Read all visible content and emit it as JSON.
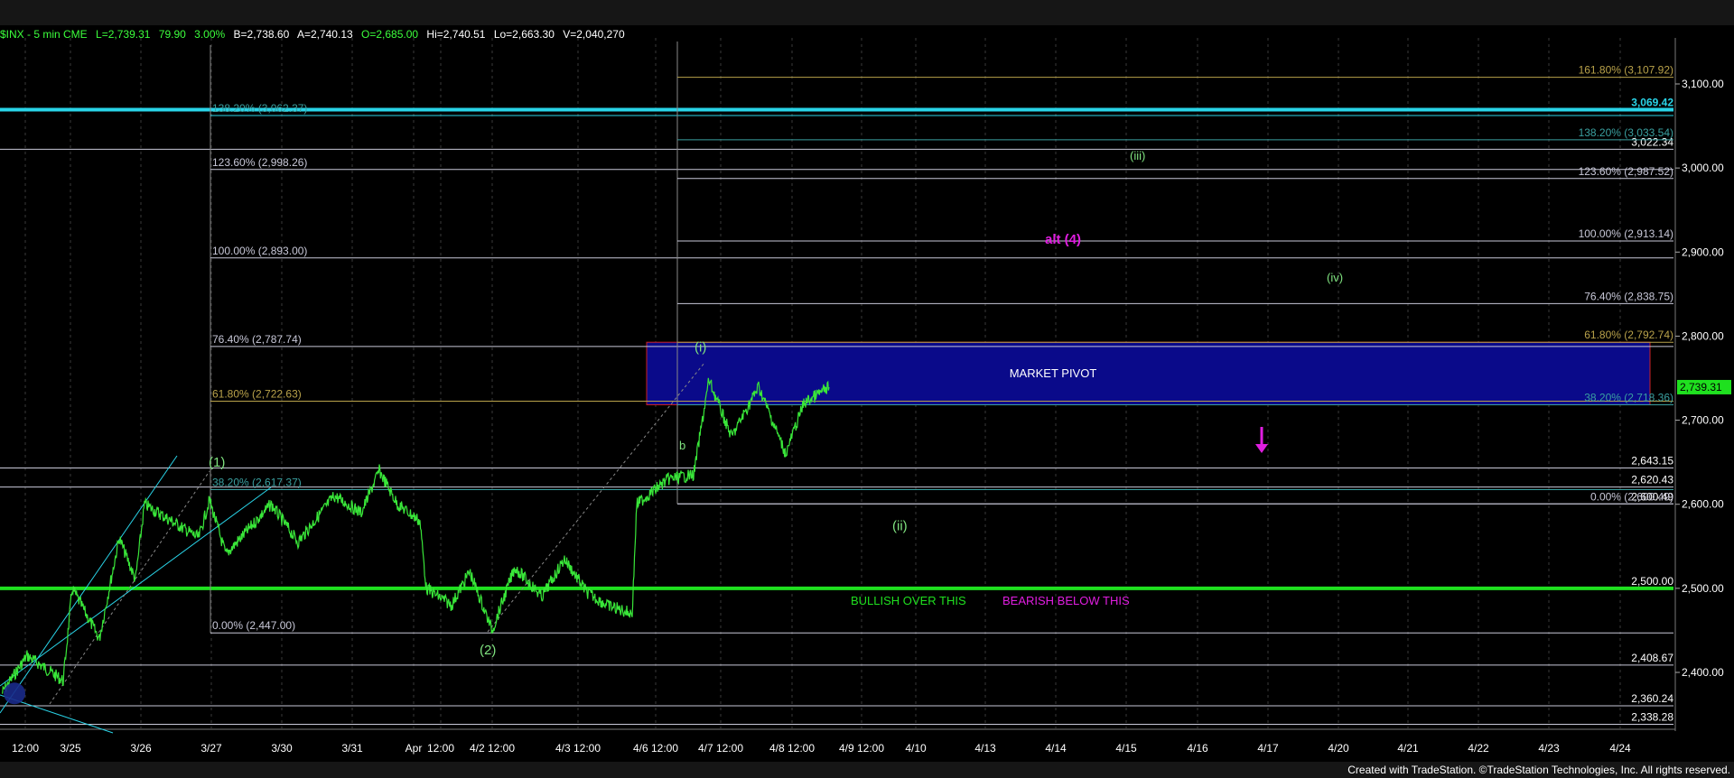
{
  "header": {
    "symbol": "$INX - 5 min  CME",
    "last": "L=2,739.31",
    "change": "79.90",
    "change_pct": "3.00%",
    "bid": "B=2,738.60",
    "ask": "A=2,740.13",
    "open": "O=2,685.00",
    "high": "Hi=2,740.51",
    "low": "Lo=2,663.30",
    "volume": "V=2,040,270"
  },
  "footer": "Created with TradeStation. ©TradeStation Technologies, Inc. All rights reserved.",
  "colors": {
    "price": "#39e639",
    "pivot_fill": "#0a0a8a",
    "pivot_border": "#cc2222",
    "support_line": "#1fe01f",
    "cyan_line": "#29d4e8",
    "fib_gold": "#b9a24a",
    "fib_teal": "#3aa0a0",
    "fib_white": "#c8c8d8",
    "magenta": "#e01ee0",
    "wave_green": "#7fe27f"
  },
  "chart_data": {
    "type": "line",
    "symbol": "$INX",
    "interval": "5 min",
    "last_price": 2739.31,
    "y_axis": {
      "ylim": [
        2325,
        3160
      ],
      "ticks": [
        2400,
        2500,
        2600,
        2700,
        2800,
        2900,
        3000,
        3100
      ],
      "tick_labels": [
        "2,400.00",
        "2,500.00",
        "2,600.00",
        "2,700.00",
        "2,800.00",
        "2,900.00",
        "3,000.00",
        "3,100.00"
      ],
      "last_label": "2,739.31"
    },
    "x_axis": {
      "labels": [
        "12:00",
        "3/25",
        "3/26",
        "3/27",
        "3/30",
        "3/31",
        "Apr",
        "12:00",
        "4/2 12:00",
        "4/3 12:00",
        "4/6 12:00",
        "4/7 12:00",
        "4/8 12:00",
        "4/9 12:00",
        "4/10",
        "4/13",
        "4/14",
        "4/15",
        "4/16",
        "4/17",
        "4/20",
        "4/21",
        "4/22",
        "4/23",
        "4/24"
      ]
    },
    "series": [
      {
        "x": [
          "3/24 12:00",
          "3/24 14:00",
          "3/25 10:00",
          "3/25 12:00",
          "3/25 14:00",
          "3/25 15:00",
          "3/26 10:00",
          "3/26 12:00",
          "3/26 15:00",
          "3/27 10:00",
          "3/27 12:00",
          "3/27 15:00",
          "3/30 10:00",
          "3/30 12:00",
          "3/30 15:00",
          "3/31 10:00",
          "3/31 12:00",
          "3/31 15:00",
          "4/1 10:00",
          "4/1 12:00",
          "4/1 15:00",
          "4/2 10:00",
          "4/2 12:00",
          "4/2 15:00",
          "4/3 10:00",
          "4/3 12:00",
          "4/3 15:00",
          "4/6 10:00",
          "4/6 12:00",
          "4/6 15:00",
          "4/7 09:45",
          "4/7 11:00",
          "4/7 13:00",
          "4/7 15:00",
          "4/8 10:00",
          "4/8 11:30",
          "4/8 14:00",
          "4/8 16:00"
        ],
        "y": [
          2375,
          2420,
          2390,
          2500,
          2440,
          2560,
          2510,
          2600,
          2560,
          2605,
          2540,
          2600,
          2555,
          2610,
          2590,
          2640,
          2600,
          2580,
          2500,
          2480,
          2520,
          2450,
          2525,
          2490,
          2535,
          2495,
          2480,
          2470,
          2600,
          2630,
          2635,
          2748,
          2680,
          2740,
          2700,
          2660,
          2720,
          2739.31
        ]
      }
    ],
    "horizontal_levels": [
      3069.42,
      3022.34,
      2643.15,
      2620.43,
      2600.49,
      2500.0,
      2408.67,
      2360.24,
      2338.28
    ],
    "level_labels": [
      "3,069.42",
      "3,022.34",
      "2,643.15",
      "2,620.43",
      "2,600.49",
      "2,500.00",
      "2,408.67",
      "2,360.24",
      "2,338.28"
    ],
    "fib_left": [
      {
        "value": 3062.37,
        "label": "138.20% (3,062.37)"
      },
      {
        "value": 2998.26,
        "label": "123.60% (2,998.26)"
      },
      {
        "value": 2893.0,
        "label": "100.00% (2,893.00)"
      },
      {
        "value": 2787.74,
        "label": "76.40% (2,787.74)"
      },
      {
        "value": 2722.63,
        "label": "61.80% (2,722.63)"
      },
      {
        "value": 2617.37,
        "label": "38.20% (2,617.37)"
      },
      {
        "value": 2447.0,
        "label": "0.00% (2,447.00)"
      }
    ],
    "fib_right": [
      {
        "value": 3107.92,
        "label": "161.80% (3,107.92)"
      },
      {
        "value": 3033.54,
        "label": "138.20% (3,033.54)"
      },
      {
        "value": 2987.52,
        "label": "123.60% (2,987.52)"
      },
      {
        "value": 2913.14,
        "label": "100.00% (2,913.14)"
      },
      {
        "value": 2838.75,
        "label": "76.40% (2,838.75)"
      },
      {
        "value": 2792.74,
        "label": "61.80% (2,792.74)"
      },
      {
        "value": 2718.36,
        "label": "38.20% (2,718.36)"
      },
      {
        "value": 2600.49,
        "label": "0.00% (2,600.49)"
      }
    ],
    "pivot_zone": {
      "low": 2718.36,
      "high": 2792.74,
      "label": "MARKET PIVOT"
    },
    "annotations": {
      "bullish": "BULLISH OVER THIS",
      "bearish": "BEARISH BELOW THIS",
      "alt4": "alt (4)",
      "wave_1": "(1)",
      "wave_2": "(2)",
      "wave_i": "(i)",
      "wave_ii": "(ii)",
      "wave_iii": "(iii)",
      "wave_iv": "(iv)",
      "wave_b": "b"
    }
  }
}
